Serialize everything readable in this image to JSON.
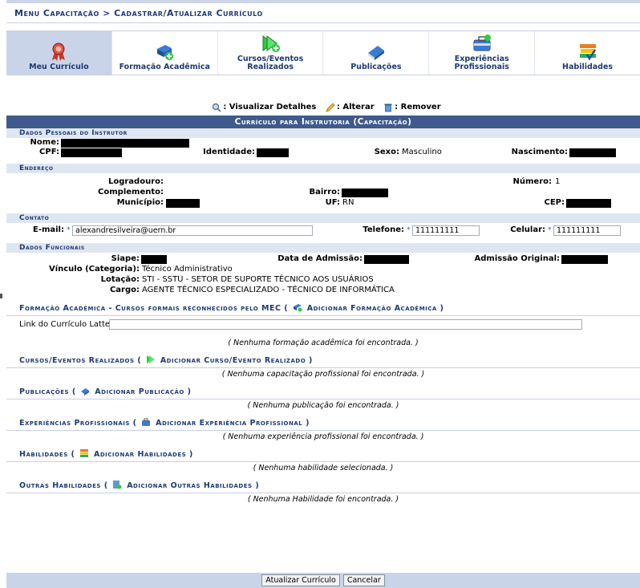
{
  "breadcrumb": "Menu Capacitação > Cadastrar/Atualizar Currículo",
  "tabs": [
    {
      "label": "Meu Currículo",
      "icon": "ribbon-medal-icon"
    },
    {
      "label": "Formação Acadêmica",
      "icon": "book-add-icon"
    },
    {
      "label": "Cursos/Eventos Realizados",
      "icon": "green-arrow-add-icon"
    },
    {
      "label": "Publicações",
      "icon": "blue-book-icon"
    },
    {
      "label": "Experiências Profissionais",
      "icon": "briefcase-icon"
    },
    {
      "label": "Habilidades",
      "icon": "books-check-icon"
    }
  ],
  "legend": {
    "view": ": Visualizar Detalhes",
    "edit": ": Alterar",
    "remove": ": Remover"
  },
  "form": {
    "caption": "Currículo para Instrutoria (Capacitação)",
    "personal": {
      "title": "Dados Pessoais do Instrutor",
      "name_label": "Nome:",
      "cpf_label": "CPF:",
      "id_label": "Identidade:",
      "sex_label": "Sexo:",
      "sex_value": "Masculino",
      "birth_label": "Nascimento:"
    },
    "address": {
      "title": "Endereço",
      "street_label": "Logradouro:",
      "number_label": "Número:",
      "number_value": "1",
      "complement_label": "Complemento:",
      "district_label": "Bairro:",
      "city_label": "Município:",
      "uf_label": "UF:",
      "uf_value": "RN",
      "cep_label": "CEP:"
    },
    "contact": {
      "title": "Contato",
      "email_label": "E-mail:",
      "email_value": "alexandresilveira@uern.br",
      "phone_label": "Telefone:",
      "phone_value": "111111111",
      "cell_label": "Celular:",
      "cell_value": "111111111",
      "required_mark": "*"
    },
    "functional": {
      "title": "Dados Funcionais",
      "siape_label": "Siape:",
      "admission_label": "Data de Admissão:",
      "orig_admission_label": "Admissão Original:",
      "bond_label": "Vínculo (Categoria):",
      "bond_value": "Técnico Administrativo",
      "unit_label": "Lotação:",
      "unit_value": "STI - SSTU - SETOR DE SUPORTE TÉCNICO AOS USUÁRIOS",
      "role_label": "Cargo:",
      "role_value": "AGENTE TÉCNICO ESPECIALIZADO - TÉCNICO DE INFORMÁTICA"
    },
    "academic": {
      "title": "Formação Acadêmica - Cursos formais reconhecidos pelo MEC (",
      "add": "Adicionar Formação Acadêmica",
      "close": ")",
      "lattes_label": "Link do Currículo Lattes:",
      "lattes_value": "",
      "empty": "( Nenhuma formação acadêmica foi encontrada. )"
    },
    "courses": {
      "title": "Cursos/Eventos Realizados (",
      "add": "Adicionar Curso/Evento Realizado",
      "close": ")",
      "empty": "( Nenhuma capacitação profissional foi encontrada. )"
    },
    "publications": {
      "title": "Publicações (",
      "add": "Adicionar Publicação",
      "close": ")",
      "empty": "( Nenhuma publicação foi encontrada. )"
    },
    "experiences": {
      "title": "Experiências Profissionais (",
      "add": "Adicionar Experiência Profissional",
      "close": ")",
      "empty": "( Nenhuma experiência profissional foi encontrada. )"
    },
    "skills": {
      "title": "Habilidades (",
      "add": "Adicionar Habilidades",
      "close": ")",
      "empty": "( Nenhuma habilidade selecionada. )"
    },
    "other_skills": {
      "title": "Outras Habilidades (",
      "add": "Adicionar Outras Habilidades",
      "close": ")",
      "empty": "( Nenhuma Habilidade foi encontrada. )"
    }
  },
  "buttons": {
    "update": "Atualizar Currículo",
    "cancel": "Cancelar"
  }
}
